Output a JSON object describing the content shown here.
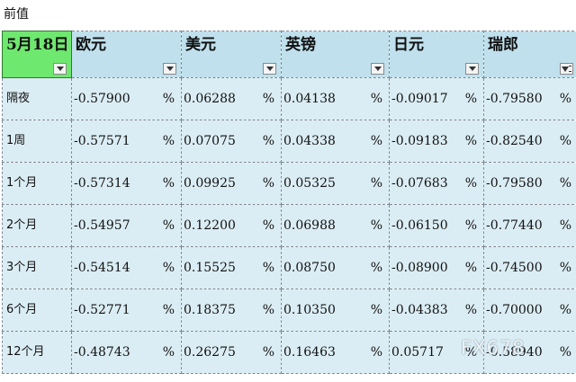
{
  "caption": "前值",
  "table": {
    "headers": [
      "5月18日",
      "欧元",
      "美元",
      "英镑",
      "日元",
      "瑞郎"
    ],
    "rows": [
      {
        "label": "隔夜",
        "values": [
          "-0.57900",
          "0.06288",
          "0.04138",
          "-0.09017",
          "-0.79580"
        ]
      },
      {
        "label": "1周",
        "values": [
          "-0.57571",
          "0.07075",
          "0.04338",
          "-0.09183",
          "-0.82540"
        ]
      },
      {
        "label": "1个月",
        "values": [
          "-0.57314",
          "0.09925",
          "0.05325",
          "-0.07683",
          "-0.79580"
        ]
      },
      {
        "label": "2个月",
        "values": [
          "-0.54957",
          "0.12200",
          "0.06988",
          "-0.06150",
          "-0.77440"
        ]
      },
      {
        "label": "3个月",
        "values": [
          "-0.54514",
          "0.15525",
          "0.08750",
          "-0.08900",
          "-0.74500"
        ]
      },
      {
        "label": "6个月",
        "values": [
          "-0.52771",
          "0.18375",
          "0.10350",
          "-0.04383",
          "-0.70000"
        ]
      },
      {
        "label": "12个月",
        "values": [
          "-0.48743",
          "0.26275",
          "0.16463",
          "0.05717",
          "-0.58940"
        ]
      }
    ],
    "unit": "%"
  },
  "filter_icons": [
    "dropdown-arrow-icon",
    "dropdown-arrow-icon",
    "dropdown-arrow-icon",
    "dropdown-arrow-icon",
    "dropdown-arrow-icon",
    "filter-active-icon"
  ],
  "watermark": "FX678",
  "colors": {
    "date_header_bg": "#6ee86e",
    "header_bg": "#bfe0ec",
    "cell_bg": "#dbedf4"
  }
}
